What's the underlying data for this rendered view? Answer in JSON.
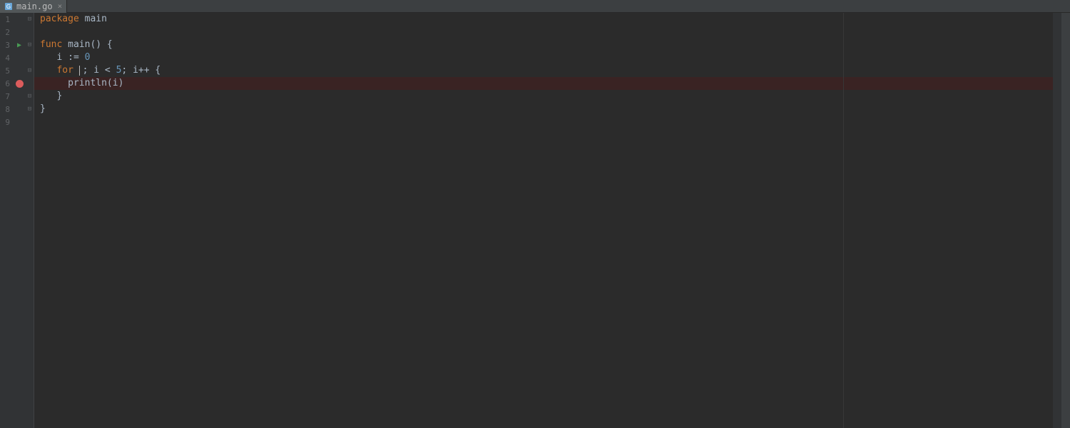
{
  "tab": {
    "filename": "main.go",
    "close_symbol": "×"
  },
  "lines": {
    "n1": "1",
    "n2": "2",
    "n3": "3",
    "n4": "4",
    "n5": "5",
    "n6": "6",
    "n7": "7",
    "n8": "8",
    "n9": "9"
  },
  "code": {
    "l1_kw": "package",
    "l1_txt": " main",
    "l3_kw": "func",
    "l3_fn": " main",
    "l3_rest": "() {",
    "l4_pre": "   i ",
    "l4_op": ":=",
    "l4_sp": " ",
    "l4_num": "0",
    "l5_pre": "   ",
    "l5_kw": "for",
    "l5_mid": " ; i < ",
    "l5_num": "5",
    "l5_rest": "; i++ {",
    "l6_pre": "     println(i)",
    "l7": "   }",
    "l8": "}"
  },
  "icons": {
    "run": "▶",
    "fold_open": "⊟",
    "fold_close": "⊟"
  }
}
